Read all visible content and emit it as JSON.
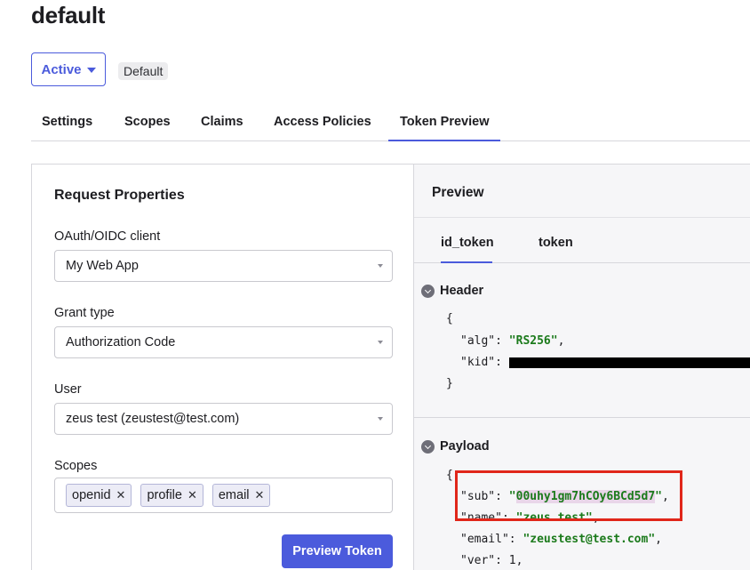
{
  "page": {
    "title": "default"
  },
  "status": {
    "label": "Active",
    "badge": "Default"
  },
  "tabs": [
    {
      "label": "Settings"
    },
    {
      "label": "Scopes"
    },
    {
      "label": "Claims"
    },
    {
      "label": "Access Policies"
    },
    {
      "label": "Token Preview",
      "active": true
    }
  ],
  "request": {
    "title": "Request Properties",
    "client": {
      "label": "OAuth/OIDC client",
      "value": "My Web App"
    },
    "grant": {
      "label": "Grant type",
      "value": "Authorization Code"
    },
    "user": {
      "label": "User",
      "value": "zeus test (zeustest@test.com)"
    },
    "scopes": {
      "label": "Scopes",
      "items": [
        "openid",
        "profile",
        "email"
      ]
    },
    "button": "Preview Token"
  },
  "preview": {
    "title": "Preview",
    "tabs": [
      "id_token",
      "token"
    ],
    "header": {
      "title": "Header",
      "open": "{",
      "close": "}",
      "alg_key": "\"alg\": ",
      "alg_val": "\"RS256\"",
      "kid_key": "\"kid\": "
    },
    "payload": {
      "title": "Payload",
      "open": "{",
      "sub_key": "\"sub\": ",
      "sub_val": "\"00uhy1gm7hCOy6BCd5d7\"",
      "name_key": "\"name\": ",
      "name_val": "\"zeus test\"",
      "email_key": "\"email\": ",
      "email_val": "\"zeustest@test.com\"",
      "ver_key": "\"ver\": ",
      "ver_val": "1"
    }
  },
  "colors": {
    "accent": "#4b5bdc",
    "string": "#1b7a1b",
    "highlight": "#e0261a"
  }
}
